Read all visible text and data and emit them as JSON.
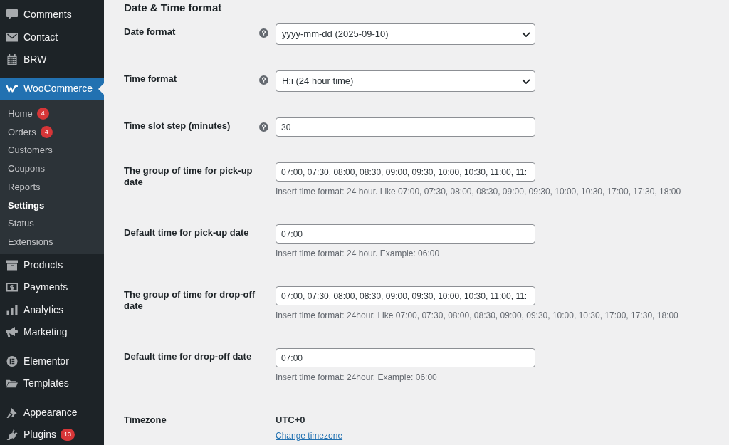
{
  "sidebar": {
    "groups": [
      {
        "items": [
          {
            "label": "Comments",
            "selected": false
          },
          {
            "label": "Contact",
            "selected": false
          },
          {
            "label": "BRW",
            "selected": false
          }
        ]
      },
      {
        "items": [
          {
            "label": "WooCommerce",
            "selected": true,
            "children": [
              {
                "label": "Home",
                "badge": "4",
                "selected": false
              },
              {
                "label": "Orders",
                "badge": "4",
                "selected": false
              },
              {
                "label": "Customers",
                "selected": false
              },
              {
                "label": "Coupons",
                "selected": false
              },
              {
                "label": "Reports",
                "selected": false
              },
              {
                "label": "Settings",
                "selected": true
              },
              {
                "label": "Status",
                "selected": false
              },
              {
                "label": "Extensions",
                "selected": false
              }
            ]
          },
          {
            "label": "Products",
            "selected": false
          },
          {
            "label": "Payments",
            "selected": false
          },
          {
            "label": "Analytics",
            "selected": false
          },
          {
            "label": "Marketing",
            "selected": false
          }
        ]
      },
      {
        "items": [
          {
            "label": "Elementor",
            "selected": false
          },
          {
            "label": "Templates",
            "selected": false
          }
        ]
      },
      {
        "items": [
          {
            "label": "Appearance",
            "selected": false
          },
          {
            "label": "Plugins",
            "badge": "13",
            "selected": false
          }
        ]
      }
    ]
  },
  "section": {
    "title": "Date & Time format",
    "fields": [
      {
        "kind": "select",
        "label": "Date format",
        "help": true,
        "value": "yyyy-mm-dd (2025-09-10)"
      },
      {
        "kind": "select",
        "label": "Time format",
        "help": true,
        "value": "H:i (24 hour time)"
      },
      {
        "kind": "text",
        "label": "Time slot step (minutes)",
        "help": true,
        "value": "30"
      },
      {
        "kind": "text",
        "label": "The group of time for pick-up date",
        "help": false,
        "value": "07:00, 07:30, 08:00, 08:30, 09:00, 09:30, 10:00, 10:30, 11:00, 11:",
        "hint": "Insert time format: 24 hour. Like 07:00, 07:30, 08:00, 08:30, 09:00, 09:30, 10:00, 10:30, 17:00, 17:30, 18:00"
      },
      {
        "kind": "text",
        "label": "Default time for pick-up date",
        "help": false,
        "value": "07:00",
        "hint": "Insert time format: 24 hour. Example: 06:00"
      },
      {
        "kind": "text",
        "label": "The group of time for drop-off date",
        "help": false,
        "value": "07:00, 07:30, 08:00, 08:30, 09:00, 09:30, 10:00, 10:30, 11:00, 11:",
        "hint": "Insert time format: 24hour. Like 07:00, 07:30, 08:00, 08:30, 09:00, 09:30, 10:00, 10:30, 17:00, 17:30, 18:00"
      },
      {
        "kind": "text",
        "label": "Default time for drop-off date",
        "help": false,
        "value": "07:00",
        "hint": "Insert time format: 24hour. Example: 06:00"
      },
      {
        "kind": "static",
        "label": "Timezone",
        "help": false,
        "value": "UTC+0",
        "link": "Change timezone"
      }
    ]
  }
}
